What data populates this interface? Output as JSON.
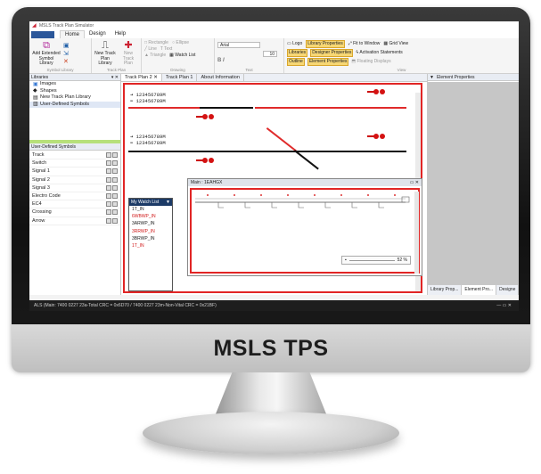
{
  "app": {
    "title": "MSLS Track Plan Simulator"
  },
  "menu": {
    "tabs": [
      "Home",
      "Design",
      "Help"
    ]
  },
  "ribbon": {
    "add_extended": "Add Extended Symbol Library",
    "new_track": "New Track Plan Library",
    "new_track_disabled": "New Track Plan",
    "rectangle": "Rectangle",
    "ellipse": "Ellipse",
    "line": "Line",
    "text": "Text",
    "triangle": "Triangle",
    "watch_list": "Watch List",
    "font_name": "Arial",
    "font_size": "10",
    "logo": "Logo",
    "library_properties": "Library Properties",
    "fit_to_window": "Fit to Window",
    "grid_view": "Grid View",
    "libraries": "Libraries",
    "designer_properties": "Designer Properties",
    "activation_statements": "Activation Statements",
    "outline": "Outline",
    "element_properties": "Element Properties",
    "floating_displays": "Floating Displays",
    "groups": [
      "Symbol Library",
      "Track Plan",
      "Drawing",
      "Text",
      "View"
    ]
  },
  "left": {
    "header": "Libraries",
    "items": [
      "Images",
      "Shapes",
      "New Track Plan Library",
      "User-Defined Symbols"
    ],
    "symbols_header": "User-Defined Symbols",
    "symbols": [
      "Track",
      "Switch",
      "Signal 1",
      "Signal 2",
      "Signal 3",
      "Electro Code",
      "EC4",
      "Crossing",
      "Arrow"
    ]
  },
  "center": {
    "tabs": [
      "Track Plan 2",
      "Track Plan 1",
      "About Information"
    ],
    "track_label": "123456789M"
  },
  "watch": {
    "title": "My Watch List",
    "items": [
      "1T_IN",
      "6WBWP_IN",
      "3ARWP_IN",
      "3RRWP_IN",
      "3BRWP_IN",
      "1T_IN"
    ],
    "red_flags": [
      false,
      true,
      false,
      true,
      false,
      true
    ]
  },
  "main_window": {
    "title": "Main : 1EAHGX",
    "zoom": "52 %"
  },
  "right": {
    "header": "Element Properties",
    "tabs": [
      "Library Prop...",
      "Element Pro...",
      "Designe"
    ]
  },
  "status": {
    "text": "ALS  (Main: 7400 0227 23a-Total CRC = 0x6D70 / 7400 0227 23m-Non-Vital CRC = 0x21BF)"
  },
  "monitor": {
    "label": "MSLS TPS"
  },
  "colors": {
    "accent": "#2b579a",
    "track_red": "#e02b2b",
    "track_black": "#111111",
    "frame_red": "#e12525"
  }
}
